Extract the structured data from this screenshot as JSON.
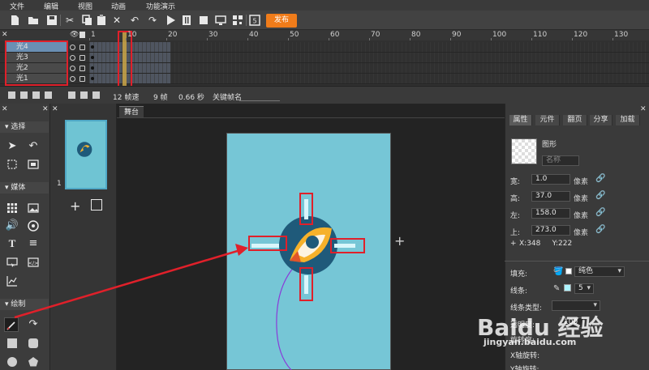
{
  "menu": [
    "文件",
    "编辑",
    "视图",
    "动画",
    "功能演示"
  ],
  "toolbar": {
    "publish_label": "发布"
  },
  "timeline": {
    "ruler_labels": [
      "1",
      "10",
      "20",
      "30",
      "40",
      "50",
      "60",
      "70",
      "80",
      "90",
      "100",
      "110",
      "120",
      "130"
    ],
    "layers": [
      {
        "name": "光4",
        "selected": true
      },
      {
        "name": "光3",
        "selected": false
      },
      {
        "name": "光2",
        "selected": false
      },
      {
        "name": "光1",
        "selected": false
      }
    ],
    "fps": "12 帧速",
    "frames": "9 帧",
    "seconds": "0.66 秒",
    "keyframe_name_label": "关键帧名"
  },
  "tools": {
    "select_label": "选择",
    "media_label": "媒体",
    "draw_label": "绘制"
  },
  "thumbs": {
    "index": "1"
  },
  "stage": {
    "tab_label": "舞台"
  },
  "props": {
    "tabs": [
      "属性",
      "元件",
      "翻页",
      "分享",
      "加载"
    ],
    "shape_label": "图形",
    "name_placeholder": "名称",
    "width_label": "宽:",
    "width_value": "1.0",
    "height_label": "高:",
    "height_value": "37.0",
    "left_label": "左:",
    "left_value": "158.0",
    "top_label": "上:",
    "top_value": "273.0",
    "unit": "像素",
    "coords": "X:348     Y:222",
    "fill_label": "填充:",
    "fill_value": "纯色",
    "stroke_label": "线条:",
    "stroke_value": "5",
    "stroke_type_label": "线条类型:",
    "opacity_label": "透明度:",
    "opacity_value": "100",
    "rotation_label": "旋转度:",
    "x_rotation_label": "X轴旋转:",
    "y_rotation_label": "Y轴旋转:"
  },
  "watermark": {
    "brand": "Baidu 经验",
    "url": "jingyan.baidu.com"
  },
  "colors": {
    "accent": "#f07c1a",
    "stage": "#76c6d6",
    "highlight": "#e0202a"
  }
}
